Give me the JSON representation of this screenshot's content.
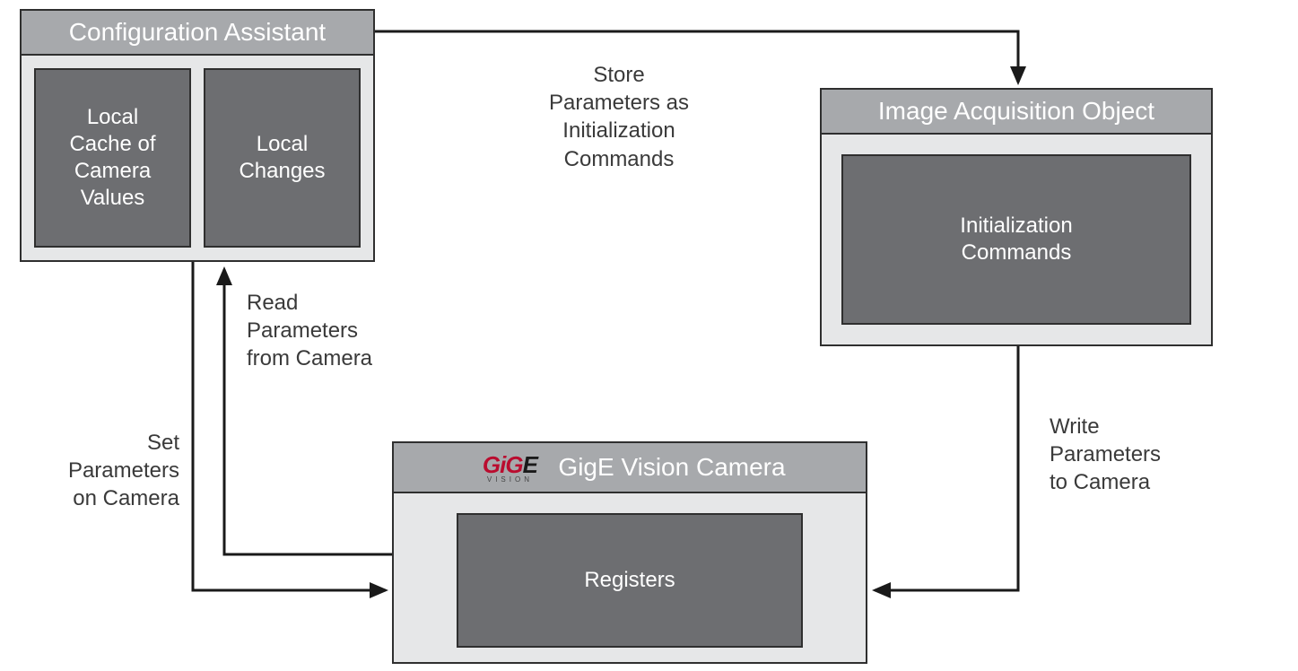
{
  "config_assistant": {
    "title": "Configuration Assistant",
    "box1": "Local\nCache of\nCamera\nValues",
    "box2": "Local\nChanges"
  },
  "image_acq": {
    "title": "Image Acquisition Object",
    "box": "Initialization\nCommands"
  },
  "camera": {
    "title_text": "GigE Vision Camera",
    "logo_main": "GiG",
    "logo_e": "E",
    "logo_sub": "VISION",
    "box": "Registers"
  },
  "labels": {
    "store": "Store\nParameters as\nInitialization\nCommands",
    "read": "Read\nParameters\nfrom Camera",
    "set": "Set\nParameters\non Camera",
    "write": "Write\nParameters\nto Camera"
  }
}
